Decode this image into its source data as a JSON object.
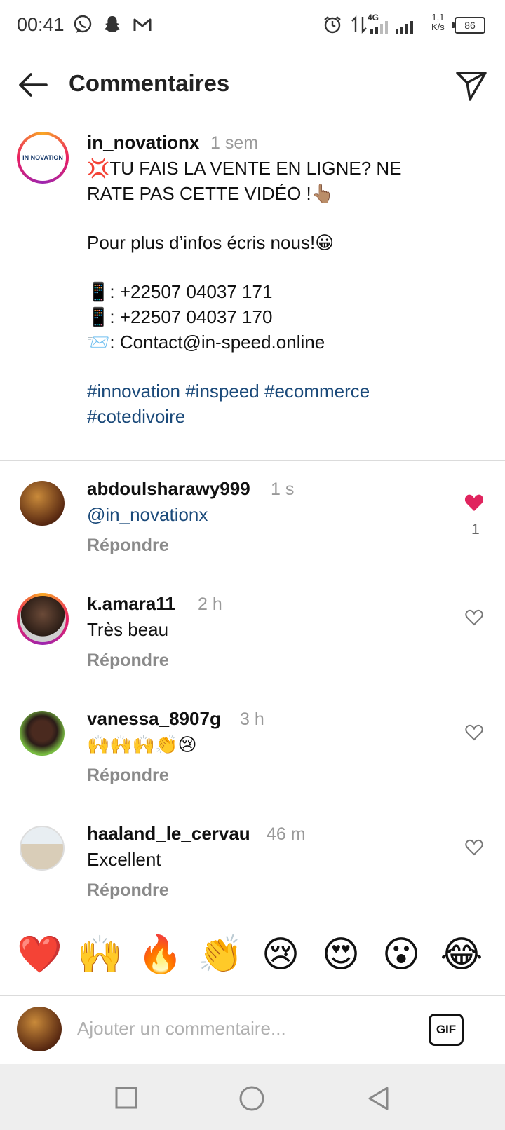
{
  "status_bar": {
    "time": "00:41",
    "network": "4G",
    "speed_value": "1,1",
    "speed_unit": "K/s",
    "battery": "86",
    "icons": [
      "whatsapp-icon",
      "snapchat-icon",
      "gmail-icon",
      "alarm-icon",
      "data-arrows-icon",
      "signal-icon",
      "signal-icon"
    ]
  },
  "header": {
    "title": "Commentaires",
    "back_icon": "arrow-left-icon",
    "share_icon": "send-icon"
  },
  "post": {
    "username": "in_novationx",
    "time": "1 sem",
    "avatar_text": "IN NOVATION",
    "line1": "💢TU FAIS LA VENTE EN LIGNE? NE",
    "line2": "RATE PAS CETTE VIDÉO !👆🏽",
    "line3": "Pour plus d’infos écris nous!😀",
    "phone1": "📱: +22507 04037 171",
    "phone2": "📱: +22507 04037 170",
    "email": "📨: Contact@in-speed.online",
    "hashtags_line1": "#innovation #inspeed #ecommerce",
    "hashtags_line2": "#cotedivoire"
  },
  "comments": [
    {
      "username": "abdoulsharawy999",
      "time": "1 s",
      "text": "@in_novationx",
      "reply": "Répondre",
      "liked": true,
      "like_count": "1"
    },
    {
      "username": "k.amara11",
      "time": "2 h",
      "text": "Très beau",
      "reply": "Répondre",
      "liked": false
    },
    {
      "username": "vanessa_8907g",
      "time": "3 h",
      "text": "🙌🙌🙌👏😢",
      "reply": "Répondre",
      "liked": false
    },
    {
      "username": "haaland_le_cervau",
      "time": "46 m",
      "text": "Excellent",
      "reply": "Répondre",
      "liked": false
    }
  ],
  "emoji_bar": [
    "❤️",
    "🙌",
    "🔥",
    "👏",
    "😢",
    "😍",
    "😮",
    "😂"
  ],
  "composer": {
    "placeholder": "Ajouter un commentaire...",
    "gif_label": "GIF"
  },
  "nav": {
    "icons": [
      "square-icon",
      "circle-icon",
      "triangle-back-icon"
    ]
  },
  "colors": {
    "hashtag": "#1b4a7a",
    "like_red": "#e0245e",
    "secondary_text": "#999999"
  }
}
